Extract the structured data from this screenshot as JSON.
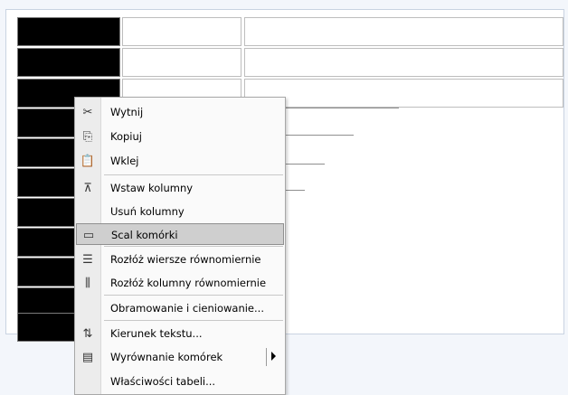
{
  "menu": {
    "items": [
      {
        "icon": "scissors-icon",
        "glyph": "✂",
        "label": "Wytnij"
      },
      {
        "icon": "copy-icon",
        "glyph": "⎘",
        "label": "Kopiuj"
      },
      {
        "icon": "paste-icon",
        "glyph": "📋",
        "label": "Wklej"
      },
      {
        "icon": "insert-columns-icon",
        "glyph": "⊼",
        "label": "Wstaw kolumny"
      },
      {
        "icon": "",
        "glyph": "",
        "label": "Usuń kolumny"
      },
      {
        "icon": "merge-cells-icon",
        "glyph": "▭",
        "label": "Scal komórki"
      },
      {
        "icon": "distribute-rows-icon",
        "glyph": "☰",
        "label": "Rozłóż wiersze równomiernie"
      },
      {
        "icon": "distribute-columns-icon",
        "glyph": "⫼",
        "label": "Rozłóż kolumny równomiernie"
      },
      {
        "icon": "",
        "glyph": "",
        "label": "Obramowanie i cieniowanie..."
      },
      {
        "icon": "text-direction-icon",
        "glyph": "⇅",
        "label": "Kierunek tekstu..."
      },
      {
        "icon": "cell-alignment-icon",
        "glyph": "▤",
        "label": "Wyrównanie komórek"
      },
      {
        "icon": "",
        "glyph": "",
        "label": "Właściwości tabeli..."
      }
    ],
    "highlighted": "Scal komórki"
  }
}
